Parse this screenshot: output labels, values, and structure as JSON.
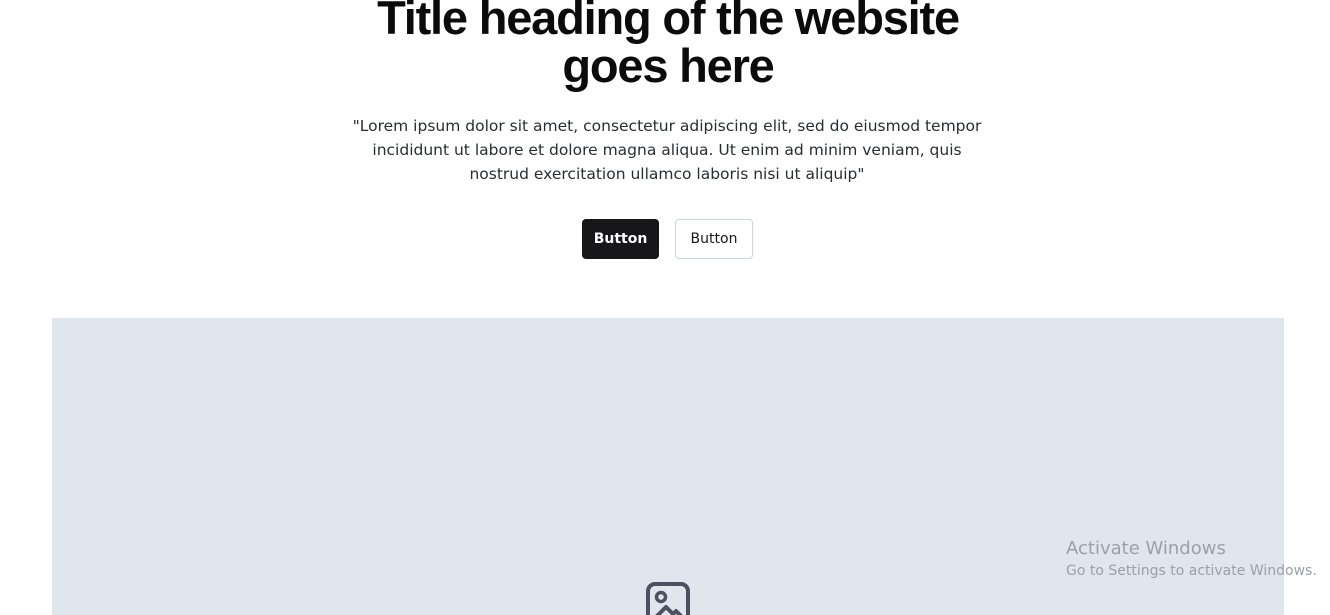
{
  "hero": {
    "title_line1": "Title heading of the website",
    "title_line2": "goes here",
    "description": "\"Lorem ipsum dolor sit amet, consectetur adipiscing elit, sed do eiusmod tempor incididunt ut labore et dolore magna aliqua. Ut enim ad minim veniam, quis nostrud exercitation ullamco laboris nisi ut aliquip\"",
    "primary_button_label": "Button",
    "secondary_button_label": "Button"
  },
  "media": {
    "icon": "image-icon",
    "background_color": "#e0e6ee"
  },
  "watermark": {
    "title": "Activate Windows",
    "subtitle": "Go to Settings to activate Windows."
  },
  "colors": {
    "primary_button": "#17171a",
    "text": "#0b0b0b",
    "muted_text": "#2b2d35",
    "border": "#cfd3dc"
  }
}
